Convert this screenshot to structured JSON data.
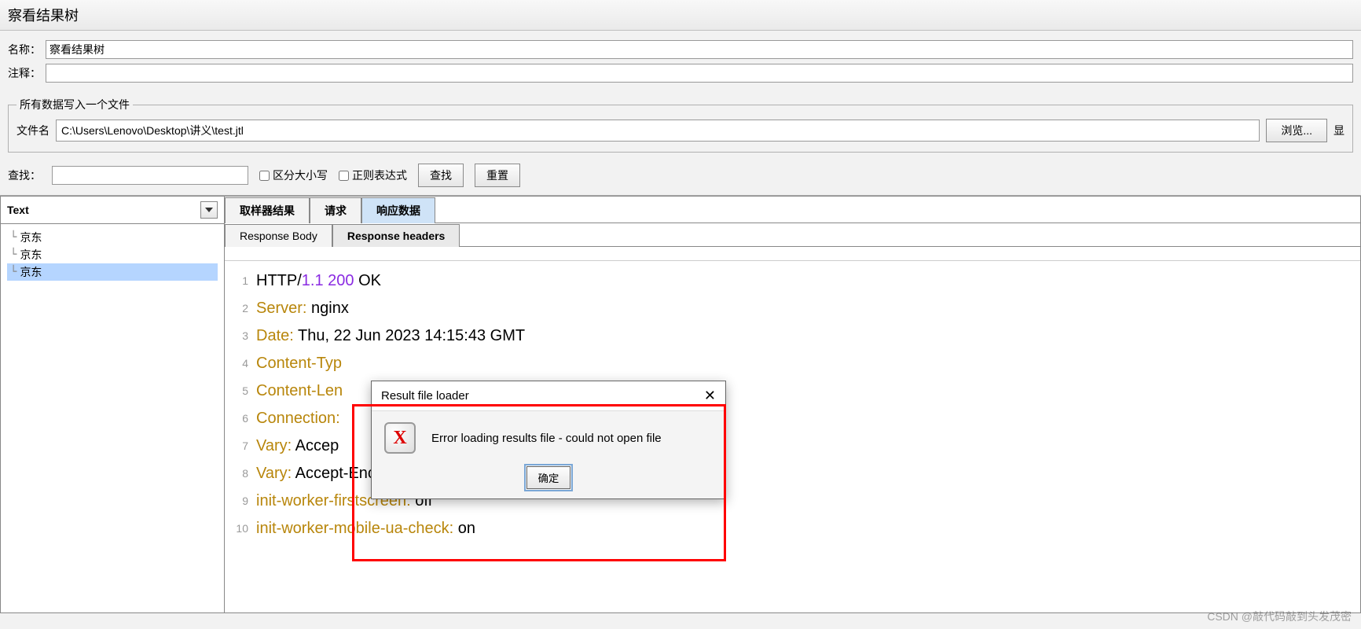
{
  "titlebar": "察看结果树",
  "form": {
    "name_label": "名称：",
    "name_value": "察看结果树",
    "comment_label": "注释：",
    "comment_value": ""
  },
  "fieldset": {
    "legend": "所有数据写入一个文件",
    "file_label": "文件名",
    "file_value": "C:\\Users\\Lenovo\\Desktop\\讲义\\test.jtl",
    "browse_label": "浏览...",
    "extra_label": "显"
  },
  "search": {
    "label": "查找：",
    "value": "",
    "case_label": "区分大小写",
    "regex_label": "正则表达式",
    "find_label": "查找",
    "reset_label": "重置"
  },
  "tree": {
    "combo_label": "Text",
    "items": [
      "京东",
      "京东",
      "京东"
    ],
    "selected_index": 2
  },
  "tabs": {
    "primary": [
      "取样器结果",
      "请求",
      "响应数据"
    ],
    "primary_active": 2,
    "secondary": [
      "Response Body",
      "Response headers"
    ],
    "secondary_active": 1
  },
  "headers_content": {
    "lines": [
      {
        "n": "1",
        "raw": "HTTP/1.1 200 OK",
        "kind": "http"
      },
      {
        "n": "2",
        "raw": "Server: nginx",
        "name": "Server",
        "value": "nginx"
      },
      {
        "n": "3",
        "raw": "Date: Thu, 22 Jun 2023 14:15:43 GMT",
        "name": "Date",
        "value": "Thu, 22 Jun 2023 14:15:43 GMT"
      },
      {
        "n": "4",
        "raw": "Content-Typ",
        "name": "Content-Typ",
        "value": ""
      },
      {
        "n": "5",
        "raw": "Content-Len",
        "name": "Content-Len",
        "value": ""
      },
      {
        "n": "6",
        "raw": "Connection:",
        "name": "Connection",
        "value": ""
      },
      {
        "n": "7",
        "raw": "Vary: Accep",
        "name": "Vary",
        "value": "Accep"
      },
      {
        "n": "8",
        "raw": "Vary: Accept-Encoding",
        "name": "Vary",
        "value": "Accept-Encoding"
      },
      {
        "n": "9",
        "raw": "init-worker-firstscreen: off",
        "name": "init-worker-firstscreen",
        "value": "off"
      },
      {
        "n": "10",
        "raw": "init-worker-mobile-ua-check: on",
        "name": "init-worker-mobile-ua-check",
        "value": "on"
      }
    ]
  },
  "modal": {
    "title": "Result file loader",
    "message": "Error loading results file - could not open file",
    "ok_label": "确定"
  },
  "watermark": "CSDN @敲代码敲到头发茂密"
}
